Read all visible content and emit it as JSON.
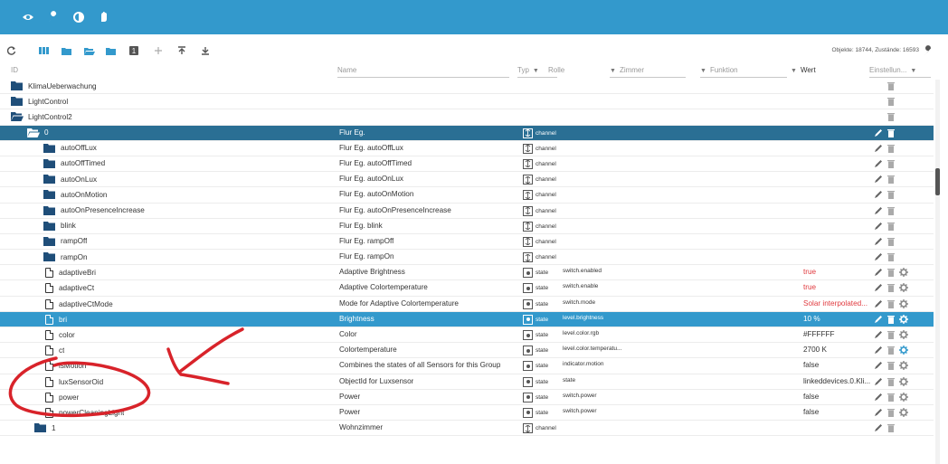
{
  "topbar": {
    "icons": [
      "eye-icon",
      "wrench-icon",
      "contrast-icon",
      "hand-icon"
    ]
  },
  "toolbar": {
    "icons": [
      "refresh-icon",
      "columns-icon",
      "folder-icon",
      "folder-open-icon",
      "folder-closed-icon",
      "number-one-icon",
      "add-icon",
      "upload-icon",
      "download-icon"
    ],
    "stats": "Objekte: 18744, Zustände: 16593",
    "settings_icon": "wrench-icon"
  },
  "header": {
    "id": "ID",
    "name": "Name",
    "type": "Typ",
    "role": "Rolle",
    "room": "Zimmer",
    "function": "Funktion",
    "value": "Wert",
    "settings": "Einstellun..."
  },
  "rows": [
    {
      "id": "KlimaUeberwachung",
      "name": "",
      "type": "",
      "role": "",
      "value": ""
    },
    {
      "id": "LightControl",
      "name": "",
      "type": "",
      "role": "",
      "value": ""
    },
    {
      "id": "LightControl2",
      "name": "",
      "type": "",
      "role": "",
      "value": ""
    },
    {
      "id": "0",
      "name": "Flur Eg.",
      "type": "channel",
      "role": "",
      "value": ""
    },
    {
      "id": "autoOffLux",
      "name": "Flur Eg. autoOffLux",
      "type": "channel",
      "role": "",
      "value": ""
    },
    {
      "id": "autoOffTimed",
      "name": "Flur Eg. autoOffTimed",
      "type": "channel",
      "role": "",
      "value": ""
    },
    {
      "id": "autoOnLux",
      "name": "Flur Eg. autoOnLux",
      "type": "channel",
      "role": "",
      "value": ""
    },
    {
      "id": "autoOnMotion",
      "name": "Flur Eg. autoOnMotion",
      "type": "channel",
      "role": "",
      "value": ""
    },
    {
      "id": "autoOnPresenceIncrease",
      "name": "Flur Eg. autoOnPresenceIncrease",
      "type": "channel",
      "role": "",
      "value": ""
    },
    {
      "id": "blink",
      "name": "Flur Eg. blink",
      "type": "channel",
      "role": "",
      "value": ""
    },
    {
      "id": "rampOff",
      "name": "Flur Eg. rampOff",
      "type": "channel",
      "role": "",
      "value": ""
    },
    {
      "id": "rampOn",
      "name": "Flur Eg. rampOn",
      "type": "channel",
      "role": "",
      "value": ""
    },
    {
      "id": "adaptiveBri",
      "name": "Adaptive Brightness",
      "type": "state",
      "role": "switch.enabled",
      "value": "true"
    },
    {
      "id": "adaptiveCt",
      "name": "Adaptive Colortemperature",
      "type": "state",
      "role": "switch.enable",
      "value": "true"
    },
    {
      "id": "adaptiveCtMode",
      "name": "Mode for Adaptive Colortemperature",
      "type": "state",
      "role": "switch.mode",
      "value": "Solar interpolated..."
    },
    {
      "id": "bri",
      "name": "Brightness",
      "type": "state",
      "role": "level.brightness",
      "value": "10 %"
    },
    {
      "id": "color",
      "name": "Color",
      "type": "state",
      "role": "level.color.rgb",
      "value": "#FFFFFF"
    },
    {
      "id": "ct",
      "name": "Colortemperature",
      "type": "state",
      "role": "level.color.temperatu...",
      "value": "2700 K"
    },
    {
      "id": "isMotion",
      "name": "Combines the states of all Sensors for this Group",
      "type": "state",
      "role": "indicator.motion",
      "value": "false"
    },
    {
      "id": "luxSensorOid",
      "name": "ObjectId for Luxsensor",
      "type": "state",
      "role": "state",
      "value": "linkeddevices.0.Kli..."
    },
    {
      "id": "power",
      "name": "Power",
      "type": "state",
      "role": "switch.power",
      "value": "false"
    },
    {
      "id": "powerCleaningLight",
      "name": "Power",
      "type": "state",
      "role": "switch.power",
      "value": "false"
    },
    {
      "id": "1",
      "name": "Wohnzimmer",
      "type": "channel",
      "role": "",
      "value": ""
    }
  ],
  "colors": {
    "primary": "#3399cc",
    "selected_dark": "#2a6f94",
    "value_red": "#e0393e",
    "annotation_red": "#d8232a"
  }
}
